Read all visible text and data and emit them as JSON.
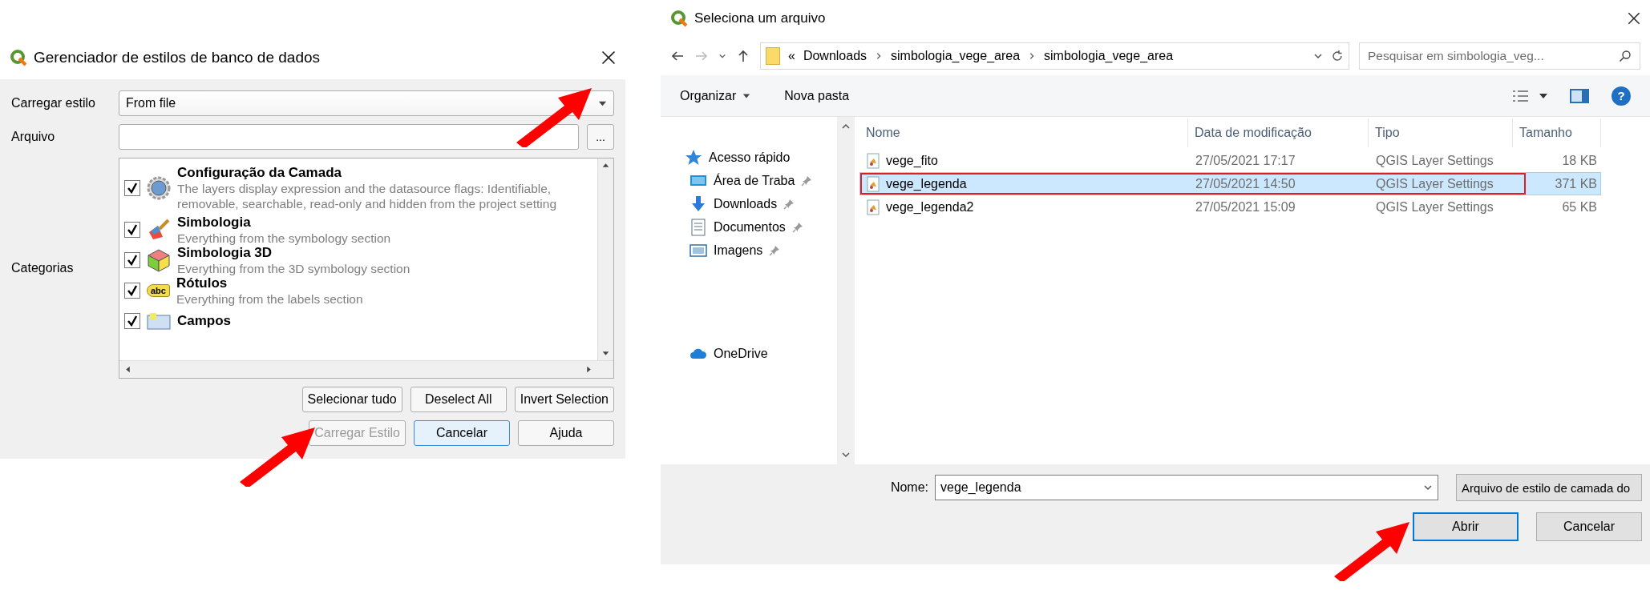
{
  "style_dialog": {
    "title": "Gerenciador de estilos de banco de dados",
    "load_style": {
      "label": "Carregar estilo",
      "value": "From file"
    },
    "file": {
      "label": "Arquivo",
      "browse": "..."
    },
    "categories_label": "Categorias",
    "categories": [
      {
        "name": "Configuração da Camada",
        "description": "The layers display expression and the datasource flags: Identifiable, removable, searchable, read-only and hidden from the project setting",
        "checked": true,
        "kind": "gear"
      },
      {
        "name": "Simbologia",
        "description": "Everything from the symbology section",
        "checked": true,
        "kind": "brush"
      },
      {
        "name": "Simbologia 3D",
        "description": "Everything from the 3D symbology section",
        "checked": true,
        "kind": "cube"
      },
      {
        "name": "Rótulos",
        "description": "Everything from the labels section",
        "checked": true,
        "kind": "label"
      },
      {
        "name": "Campos",
        "checked": true,
        "kind": "form"
      }
    ],
    "label_icon_text": "abc",
    "select_buttons": [
      "Selecionar tudo",
      "Deselect All",
      "Invert Selection"
    ],
    "buttons": [
      {
        "label": "Carregar Estilo",
        "disabled": true,
        "selected": false
      },
      {
        "label": "Cancelar",
        "disabled": false,
        "selected": true
      },
      {
        "label": "Ajuda",
        "disabled": false,
        "selected": false
      }
    ]
  },
  "file_dialog": {
    "title": "Seleciona um arquivo",
    "path": [
      "Downloads",
      "simbologia_vege_area",
      "simbologia_vege_area"
    ],
    "path_prefix": "«",
    "search": {
      "placeholder": "Pesquisar em simbologia_veg..."
    },
    "toolbar": [
      "Organizar",
      "Nova pasta"
    ],
    "help_icon": "?",
    "sidebar": [
      {
        "label": "Acesso rápido",
        "kind": "star",
        "pinned": false
      },
      {
        "label": "Área de Traba",
        "kind": "desktop",
        "pinned": true
      },
      {
        "label": "Downloads",
        "kind": "download",
        "pinned": true
      },
      {
        "label": "Documentos",
        "kind": "document",
        "pinned": true
      },
      {
        "label": "Imagens",
        "kind": "image",
        "pinned": true
      },
      {
        "label": "OneDrive",
        "kind": "cloud",
        "pinned": false
      }
    ],
    "columns": [
      "Nome",
      "Data de modificação",
      "Tipo",
      "Tamanho"
    ],
    "rows": [
      {
        "name": "vege_fito",
        "date": "27/05/2021 17:17",
        "type": "QGIS Layer Settings",
        "size": "18 KB",
        "selected": false
      },
      {
        "name": "vege_legenda",
        "date": "27/05/2021 14:50",
        "type": "QGIS Layer Settings",
        "size": "371 KB",
        "selected": true
      },
      {
        "name": "vege_legenda2",
        "date": "27/05/2021 15:09",
        "type": "QGIS Layer Settings",
        "size": "65 KB",
        "selected": false
      }
    ],
    "name_field": {
      "label": "Nome:",
      "value": "vege_legenda"
    },
    "file_type": "Arquivo de estilo de camada do",
    "buttons": [
      {
        "label": "Abrir",
        "selected": true
      },
      {
        "label": "Cancelar",
        "selected": false
      }
    ]
  }
}
